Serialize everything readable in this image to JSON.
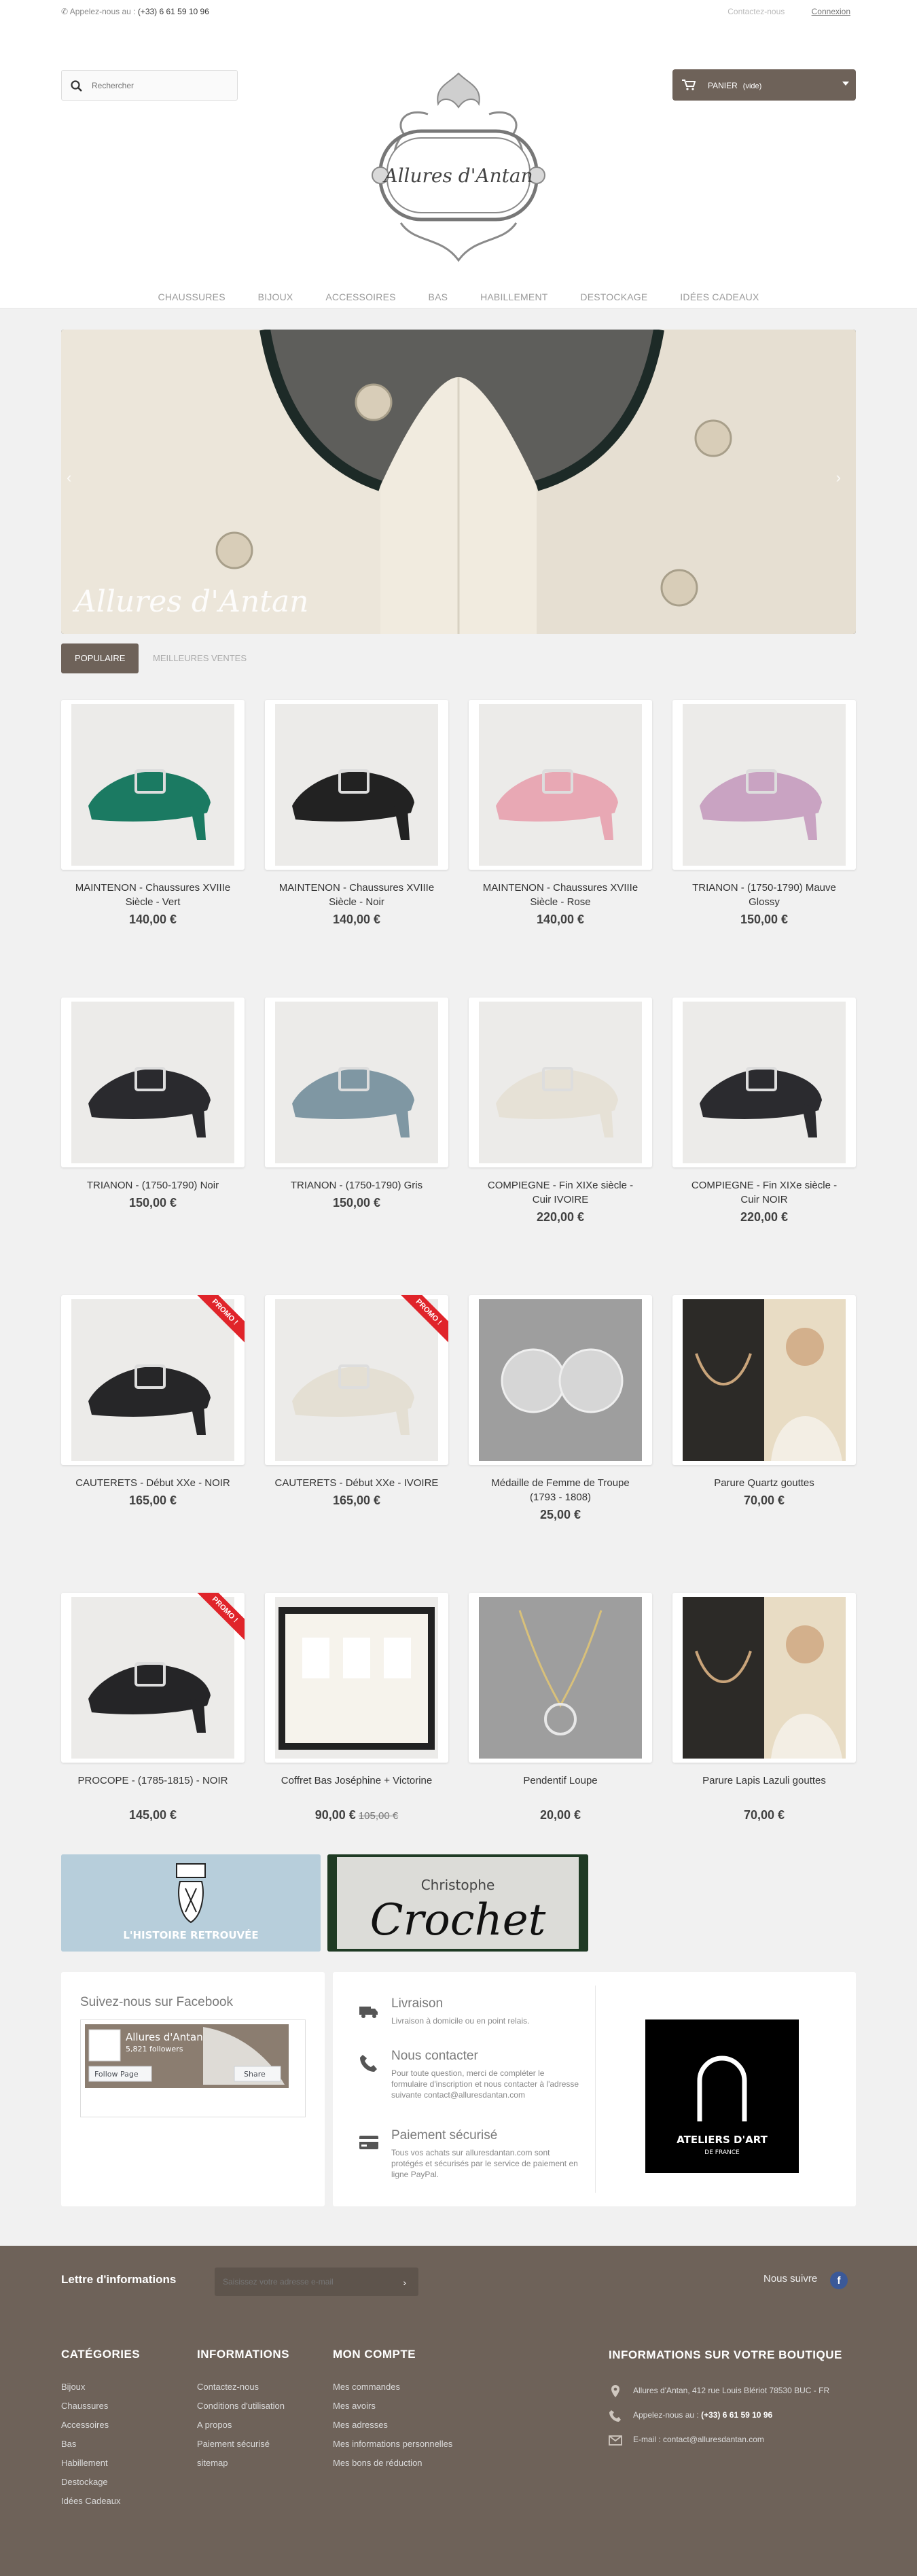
{
  "topbar": {
    "phone_label": "Appelez-nous au :",
    "phone_number": "(+33) 6 61 59 10 96",
    "contact_link": "Contactez-nous",
    "login_link": "Connexion"
  },
  "search": {
    "placeholder": "Rechercher"
  },
  "cart": {
    "label": "PANIER",
    "status": "(vide)"
  },
  "logo": {
    "text": "Allures d'Antan"
  },
  "nav": [
    "CHAUSSURES",
    "BIJOUX",
    "ACCESSOIRES",
    "BAS",
    "HABILLEMENT",
    "DESTOCKAGE",
    "IDÉES CADEAUX"
  ],
  "slider": {
    "caption": "Allures d'Antan",
    "prev": "‹",
    "next": "›"
  },
  "tabs": {
    "popular": "POPULAIRE",
    "best": "MEILLEURES VENTES"
  },
  "promo_label": "PROMO !",
  "products": [
    {
      "name": "MAINTENON - Chaussures XVIIIe Siècle - Vert",
      "price": "140,00 €",
      "old": "",
      "promo": false,
      "color": "#1b7a62"
    },
    {
      "name": "MAINTENON - Chaussures XVIIIe Siècle - Noir",
      "price": "140,00 €",
      "old": "",
      "promo": false,
      "color": "#222222"
    },
    {
      "name": "MAINTENON - Chaussures XVIIIe Siècle - Rose",
      "price": "140,00 €",
      "old": "",
      "promo": false,
      "color": "#e8a8b4"
    },
    {
      "name": "TRIANON - (1750-1790) Mauve Glossy",
      "price": "150,00 €",
      "old": "",
      "promo": false,
      "color": "#c9a3c2"
    },
    {
      "name": "TRIANON - (1750-1790) Noir",
      "price": "150,00 €",
      "old": "",
      "promo": false,
      "color": "#2a2a2e"
    },
    {
      "name": "TRIANON - (1750-1790) Gris",
      "price": "150,00 €",
      "old": "",
      "promo": false,
      "color": "#7f97a3"
    },
    {
      "name": "COMPIEGNE - Fin XIXe siècle - Cuir IVOIRE",
      "price": "220,00 €",
      "old": "",
      "promo": false,
      "color": "#e6e1d6"
    },
    {
      "name": "COMPIEGNE - Fin XIXe siècle - Cuir NOIR",
      "price": "220,00 €",
      "old": "",
      "promo": false,
      "color": "#2b2b2f"
    },
    {
      "name": "CAUTERETS - Début XXe - NOIR",
      "price": "165,00 €",
      "old": "",
      "promo": true,
      "color": "#262628"
    },
    {
      "name": "CAUTERETS - Début XXe - IVOIRE",
      "price": "165,00 €",
      "old": "",
      "promo": true,
      "color": "#e4dfd3"
    },
    {
      "name": "Médaille de Femme de Troupe (1793 - 1808)",
      "price": "25,00 €",
      "old": "",
      "promo": false,
      "color": "#b8b8b8"
    },
    {
      "name": "Parure Quartz gouttes",
      "price": "70,00 €",
      "old": "",
      "promo": false,
      "color": "#c9a47a"
    },
    {
      "name": "PROCOPE - (1785-1815) - NOIR",
      "price": "145,00 €",
      "old": "",
      "promo": true,
      "color": "#252527"
    },
    {
      "name": "Coffret Bas Joséphine + Victorine",
      "price": "90,00 €",
      "old": "105,00 €",
      "promo": false,
      "color": "#d9d2c4"
    },
    {
      "name": "Pendentif Loupe",
      "price": "20,00 €",
      "old": "",
      "promo": false,
      "color": "#bdbdbd"
    },
    {
      "name": "Parure Lapis Lazuli gouttes",
      "price": "70,00 €",
      "old": "",
      "promo": false,
      "color": "#c9a47a"
    }
  ],
  "banners": {
    "left": "L'HISTOIRE RETROUVÉE",
    "right_small": "Christophe",
    "right_big": "Crochet"
  },
  "facebook": {
    "title": "Suivez-nous sur Facebook",
    "page": "Allures d'Antan",
    "followers": "5,821 followers",
    "follow": "Follow Page",
    "share": "Share"
  },
  "reassurance": [
    {
      "title": "Livraison",
      "desc": "Livraison à domicile ou en point relais.",
      "icon": "truck-icon"
    },
    {
      "title": "Nous contacter",
      "desc": "Pour toute question, merci de compléter le formulaire d'inscription et nous contacter à l'adresse suivante contact@alluresdantan.com",
      "icon": "phone-icon"
    },
    {
      "title": "Paiement sécurisé",
      "desc": "Tous vos achats sur alluresdantan.com sont protégés et sécurisés par le service de paiement en ligne PayPal.",
      "icon": "card-icon"
    }
  ],
  "atelier": {
    "line1": "ATELIERS D'ART",
    "line2": "DE FRANCE"
  },
  "newsletter": {
    "label": "Lettre d'informations",
    "placeholder": "Saisissez votre adresse e-mail",
    "follow": "Nous suivre"
  },
  "footer": {
    "categories": {
      "title": "CATÉGORIES",
      "items": [
        "Bijoux",
        "Chaussures",
        "Accessoires",
        "Bas",
        "Habillement",
        "Destockage",
        "Idées Cadeaux"
      ]
    },
    "info": {
      "title": "INFORMATIONS",
      "items": [
        "Contactez-nous",
        "Conditions d'utilisation",
        "A propos",
        "Paiement sécurisé",
        "sitemap"
      ]
    },
    "account": {
      "title": "MON COMPTE",
      "items": [
        "Mes commandes",
        "Mes avoirs",
        "Mes adresses",
        "Mes informations personnelles",
        "Mes bons de réduction"
      ]
    },
    "store": {
      "title": "INFORMATIONS SUR VOTRE BOUTIQUE",
      "address": "Allures d'Antan, 412 rue Louis Blériot 78530 BUC - FR",
      "phone_label": "Appelez-nous au :",
      "phone": "(+33) 6 61 59 10 96",
      "email": "E-mail : contact@alluresdantan.com"
    }
  }
}
